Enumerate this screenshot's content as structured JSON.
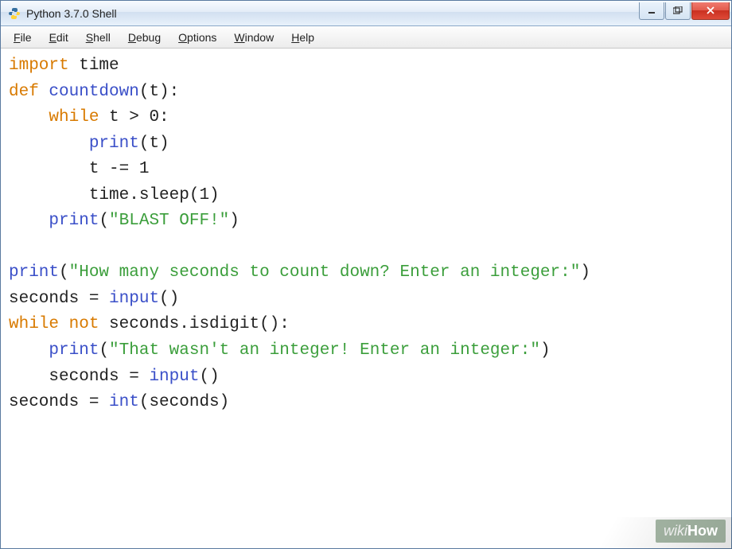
{
  "window": {
    "title": "Python 3.7.0 Shell"
  },
  "menu": {
    "file": "File",
    "edit": "Edit",
    "shell": "Shell",
    "debug": "Debug",
    "options": "Options",
    "window": "Window",
    "help": "Help"
  },
  "code": {
    "l1_kw": "import",
    "l1_mod": " time",
    "l2_kw": "def",
    "l2_fn": " countdown",
    "l2_rest": "(t):",
    "l3_indent": "    ",
    "l3_kw": "while",
    "l3_rest": " t > 0:",
    "l4_indent": "        ",
    "l4_fn": "print",
    "l4_rest": "(t)",
    "l5_indent": "        ",
    "l5_rest": "t -= 1",
    "l6_indent": "        ",
    "l6_rest": "time.sleep(1)",
    "l7_indent": "    ",
    "l7_fn": "print",
    "l7_open": "(",
    "l7_str": "\"BLAST OFF!\"",
    "l7_close": ")",
    "l9_fn": "print",
    "l9_open": "(",
    "l9_str": "\"How many seconds to count down? Enter an integer:\"",
    "l9_close": ")",
    "l10_lhs": "seconds = ",
    "l10_fn": "input",
    "l10_rest": "()",
    "l11_kw1": "while",
    "l11_sp": " ",
    "l11_kw2": "not",
    "l11_rest": " seconds.isdigit():",
    "l12_indent": "    ",
    "l12_fn": "print",
    "l12_open": "(",
    "l12_str": "\"That wasn't an integer! Enter an integer:\"",
    "l12_close": ")",
    "l13_indent": "    ",
    "l13_lhs": "seconds = ",
    "l13_fn": "input",
    "l13_rest": "()",
    "l14_lhs": "seconds = ",
    "l14_fn": "int",
    "l14_rest": "(seconds)"
  },
  "watermark": {
    "wiki": "wiki",
    "how": "How"
  }
}
